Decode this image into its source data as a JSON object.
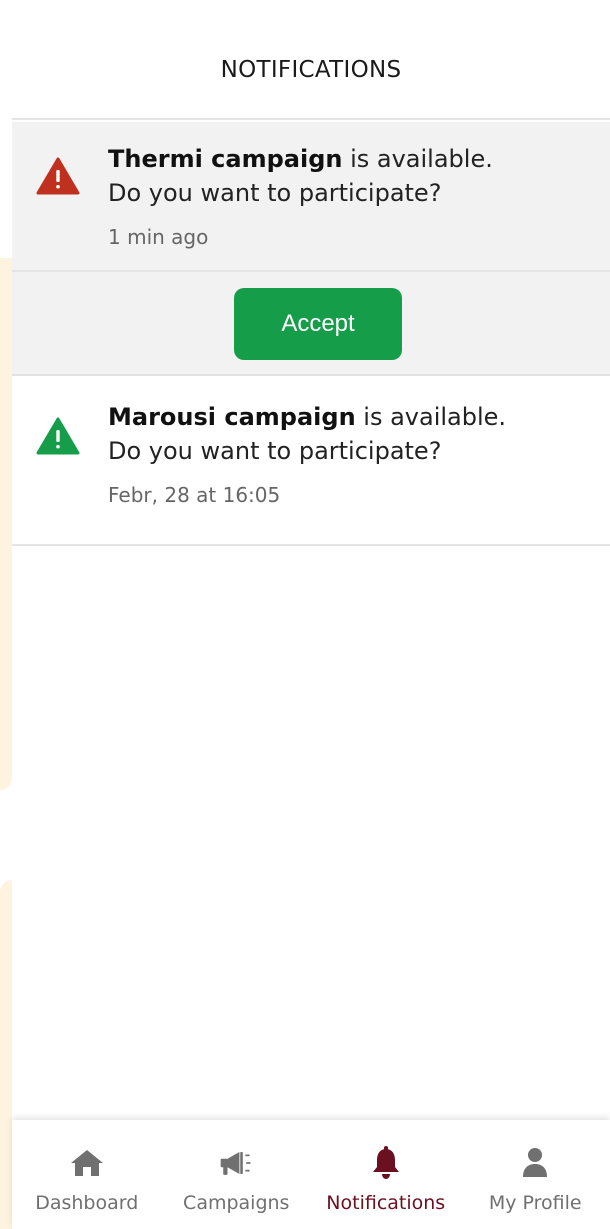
{
  "header": {
    "title": "NOTIFICATIONS"
  },
  "notifications": [
    {
      "campaign": "Thermi campaign",
      "message_rest": " is available.",
      "question": "Do you want to participate?",
      "time": "1 min ago",
      "icon": "warning-icon",
      "icon_color": "#c0301e"
    },
    {
      "campaign": "Marousi campaign",
      "message_rest": " is available.",
      "question": "Do you want to participate?",
      "time": "Febr, 28 at 16:05",
      "icon": "warning-icon",
      "icon_color": "#169d4a"
    }
  ],
  "accept_button": {
    "label": "Accept",
    "color": "#169d4a"
  },
  "bottom_nav": {
    "active": "Notifications",
    "active_color": "#6b1020",
    "items": [
      {
        "label": "Dashboard",
        "icon": "home-icon"
      },
      {
        "label": "Campaigns",
        "icon": "megaphone-icon"
      },
      {
        "label": "Notifications",
        "icon": "bell-icon"
      },
      {
        "label": "My Profile",
        "icon": "user-icon"
      }
    ]
  }
}
